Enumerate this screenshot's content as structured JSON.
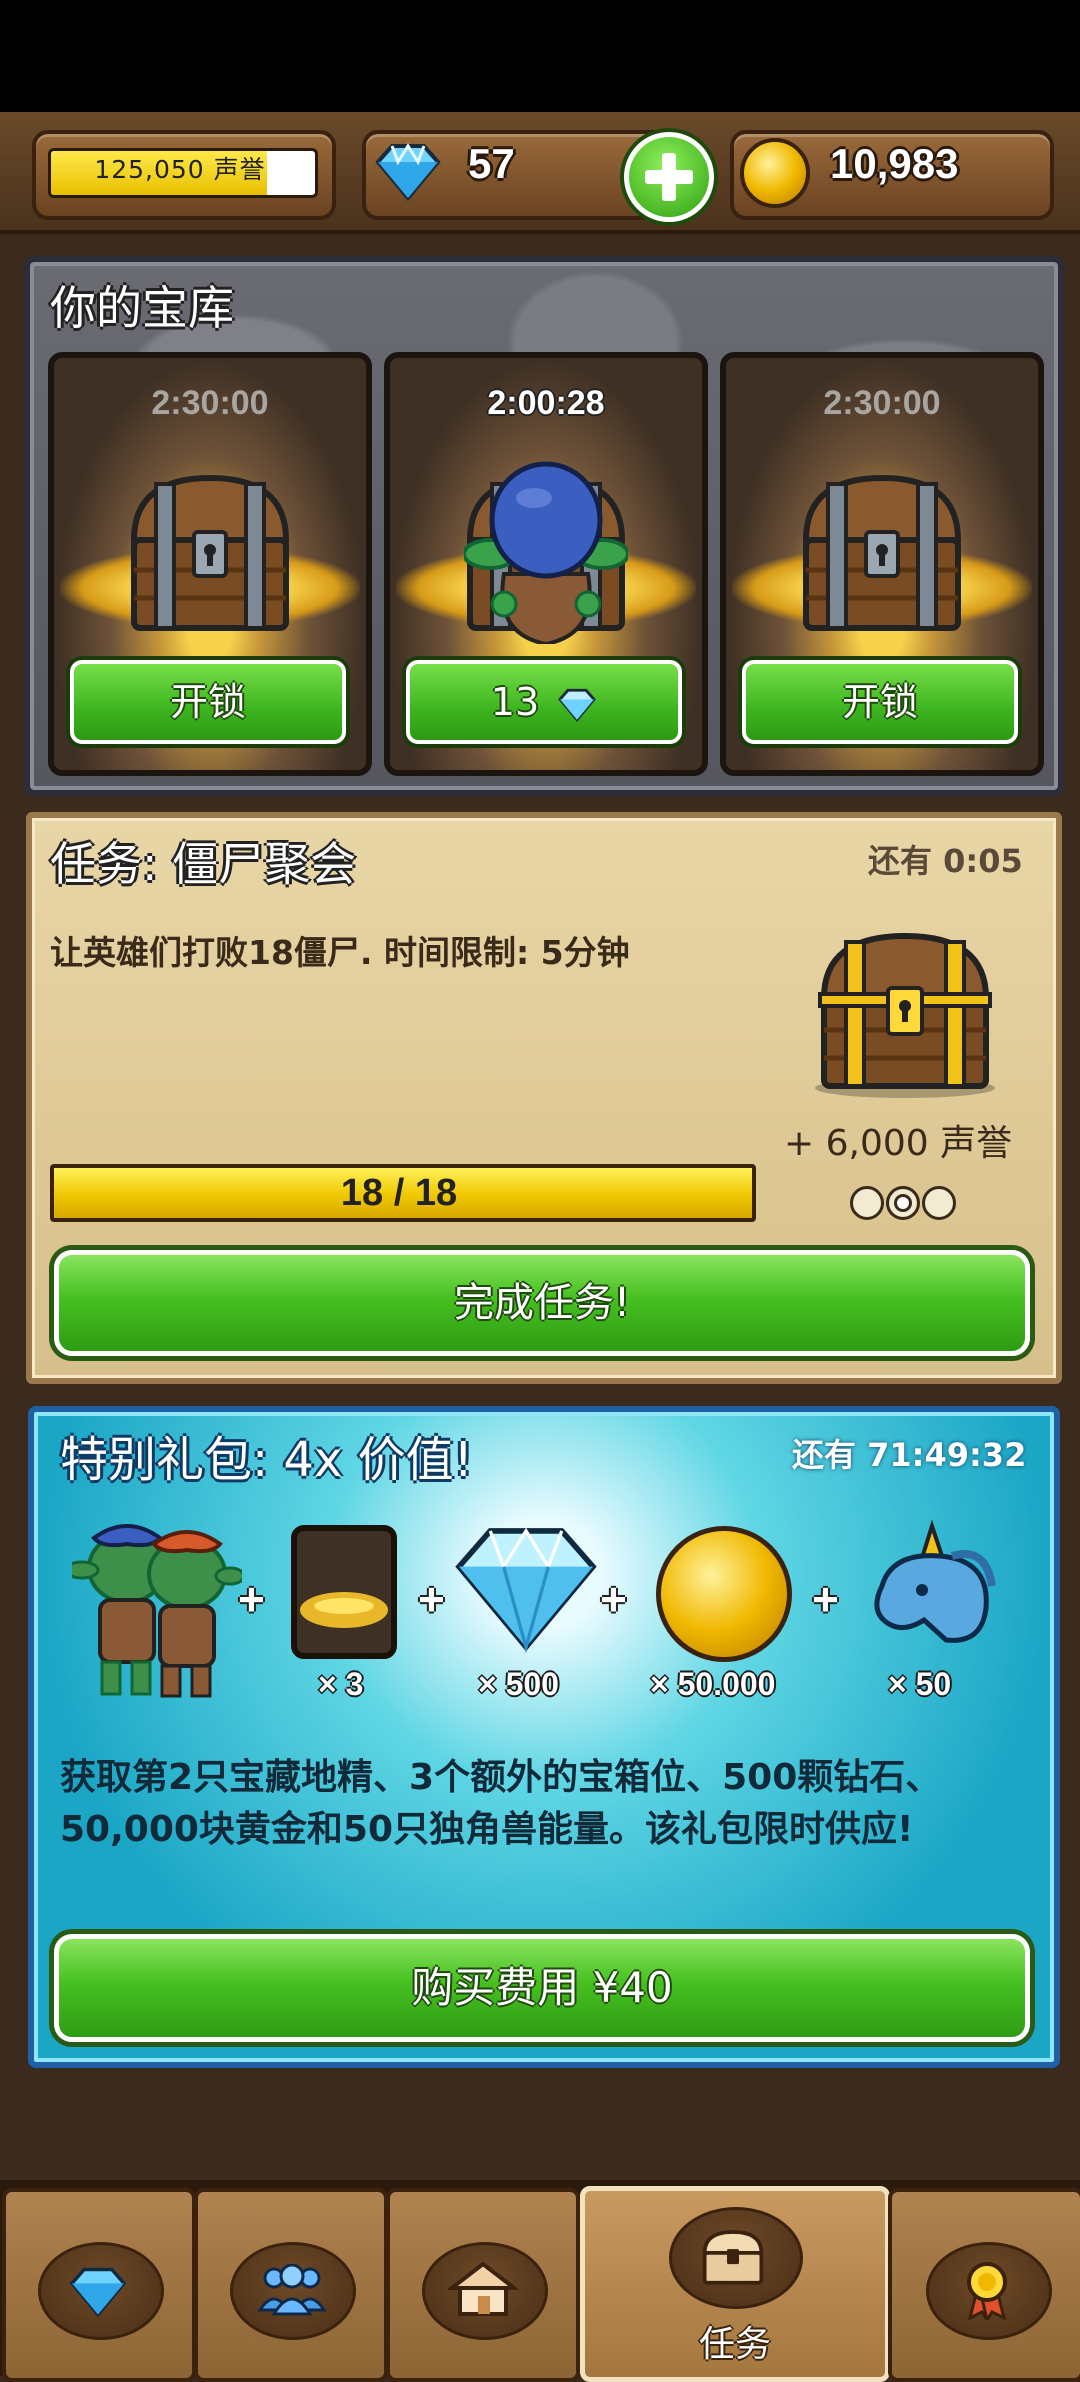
{
  "header": {
    "reputation_text": "125,050 声誉",
    "reputation_fill": 0.82,
    "gems": "57",
    "gold": "10,983",
    "icons": [
      "diamond-icon",
      "add-icon",
      "gold-coin-icon"
    ]
  },
  "vault": {
    "title": "你的宝库",
    "slots": [
      {
        "timer": "2:30:00",
        "button": "开锁",
        "state": "locked"
      },
      {
        "timer": "2:00:28",
        "button": "13",
        "state": "goblin-unlocking"
      },
      {
        "timer": "2:30:00",
        "button": "开锁",
        "state": "locked"
      }
    ]
  },
  "quest": {
    "title": "任务: 僵尸聚会",
    "time_left": "还有 0:05",
    "description": "让英雄们打败18僵尸. 时间限制: 5分钟",
    "reward": "+ 6,000 声誉",
    "progress_text": "18 / 18",
    "progress": 1.0,
    "complete_button": "完成任务!"
  },
  "offer": {
    "title": "特别礼包: 4x 价值!",
    "time_left": "还有 71:49:32",
    "items": [
      {
        "name": "goblin-pair",
        "qty": ""
      },
      {
        "name": "chest-slot-card",
        "qty": "× 3"
      },
      {
        "name": "diamond",
        "qty": "× 500"
      },
      {
        "name": "gold-coin",
        "qty": "× 50.000"
      },
      {
        "name": "unicorn",
        "qty": "× 50"
      }
    ],
    "description": "获取第2只宝藏地精、3个额外的宝箱位、500颗钻石、50,000块黄金和50只独角兽能量。该礼包限时供应!",
    "buy_button": "购买费用 ¥40"
  },
  "nav": {
    "tabs": [
      {
        "icon": "diamond-icon",
        "label": ""
      },
      {
        "icon": "heroes-icon",
        "label": ""
      },
      {
        "icon": "house-icon",
        "label": ""
      },
      {
        "icon": "chest-icon",
        "label": "任务",
        "active": true
      },
      {
        "icon": "medal-icon",
        "label": ""
      }
    ]
  },
  "colors": {
    "button_green": "#46c021",
    "progress_yellow": "#f0c800",
    "offer_cyan": "#1ba6c6",
    "parchment": "#e2cc98"
  }
}
